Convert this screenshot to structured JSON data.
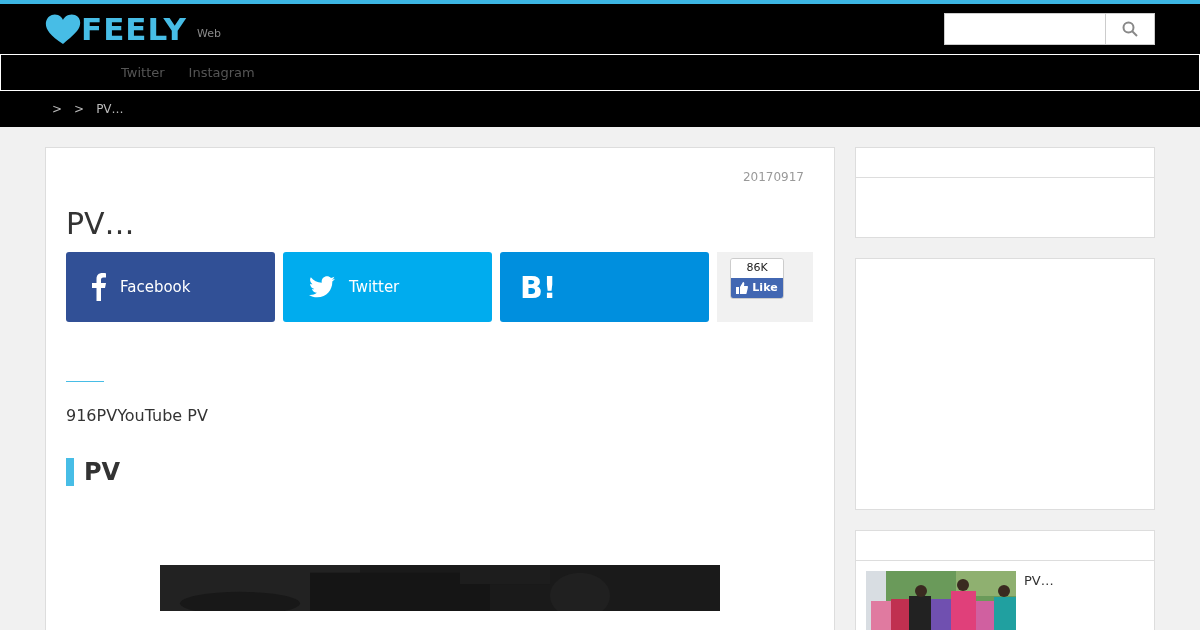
{
  "header": {
    "logo": "FEELY",
    "tagline": "Web"
  },
  "nav": [
    {
      "label": "Twitter"
    },
    {
      "label": "Instagram"
    }
  ],
  "breadcrumb": [
    ">",
    ">",
    "PV…"
  ],
  "article": {
    "date": "20170917",
    "title": "PV…",
    "share": [
      {
        "kind": "facebook",
        "label": "Facebook"
      },
      {
        "kind": "twitter",
        "label": "Twitter"
      },
      {
        "kind": "hatena",
        "label": "B!"
      },
      {
        "kind": "like",
        "count": "86K",
        "label": "Like"
      }
    ],
    "lead": "916PVYouTube PV",
    "heading": "PV"
  },
  "sidebar": [
    {
      "kind": "header-box"
    },
    {
      "kind": "ad"
    },
    {
      "kind": "list",
      "items": [
        {
          "title": "PV…"
        }
      ]
    }
  ]
}
